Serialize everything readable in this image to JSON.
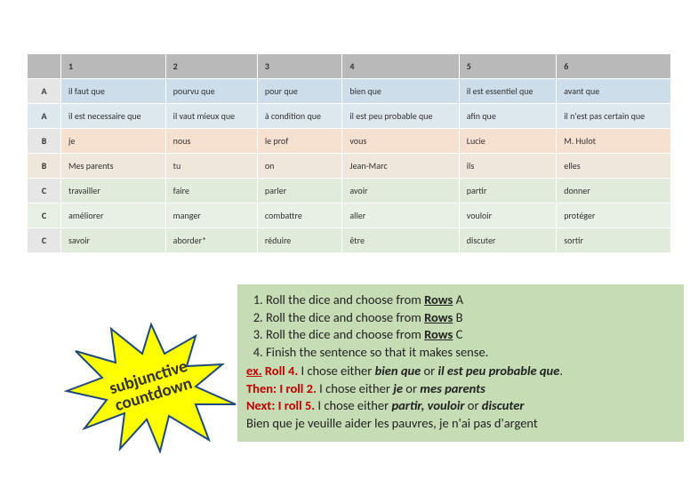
{
  "table": {
    "headers": [
      "1",
      "2",
      "3",
      "4",
      "5",
      "6"
    ],
    "rows": [
      {
        "label": "A",
        "group": "A",
        "cells": [
          "il faut que",
          "pourvu que",
          "pour que",
          "bien que",
          "il est essentiel que",
          "avant que"
        ]
      },
      {
        "label": "A",
        "group": "A",
        "cells": [
          "il est necessaire que",
          "il vaut mieux que",
          "à condition que",
          "il est peu probable que",
          "afin que",
          "il n'est pas certain que"
        ]
      },
      {
        "label": "B",
        "group": "B",
        "cells": [
          "je",
          "nous",
          "le prof",
          "vous",
          "Lucie",
          "M. Hulot"
        ]
      },
      {
        "label": "B",
        "group": "B",
        "cells": [
          "Mes parents",
          "tu",
          "on",
          "Jean-Marc",
          "ils",
          "elles"
        ]
      },
      {
        "label": "C",
        "group": "C",
        "cells": [
          "travailler",
          "faire",
          "parler",
          "avoir",
          "partir",
          "donner"
        ]
      },
      {
        "label": "C",
        "group": "C",
        "cells": [
          "améliorer",
          "manger",
          "combattre",
          "aller",
          "vouloir",
          "protéger"
        ]
      },
      {
        "label": "C",
        "group": "C",
        "cells": [
          "savoir",
          "aborder*",
          "réduire",
          "être",
          "discuter",
          "sortir"
        ]
      }
    ]
  },
  "burst": {
    "line1": "subjunctive",
    "line2": "countdown"
  },
  "instructions": {
    "steps_prefix": "Roll the dice and choose from ",
    "rows_word": "Rows",
    "step1_suffix": " A",
    "step2_suffix": " B",
    "step3_suffix": " C",
    "step4": "Finish the sentence so that it makes sense.",
    "ex_label": "ex.",
    "ex_roll": " Roll 4.",
    "ex_text": "  I chose either ",
    "ex_opt1": "bien que",
    "ex_or": " or ",
    "ex_opt2": "il est peu probable que",
    "ex_end": ".",
    "then_label": "Then: I roll 2.",
    "then_text": "  I chose either ",
    "then_opt1": "je",
    "then_or": " or ",
    "then_opt2": "mes parents",
    "next_label": "Next: I roll 5.",
    "next_text": "  I chose either ",
    "next_opts": "partir, vouloir",
    "next_or": " or ",
    "next_opt_last": "discuter",
    "final": "Bien que je veuille aider les pauvres, je n'ai pas d'argent"
  }
}
